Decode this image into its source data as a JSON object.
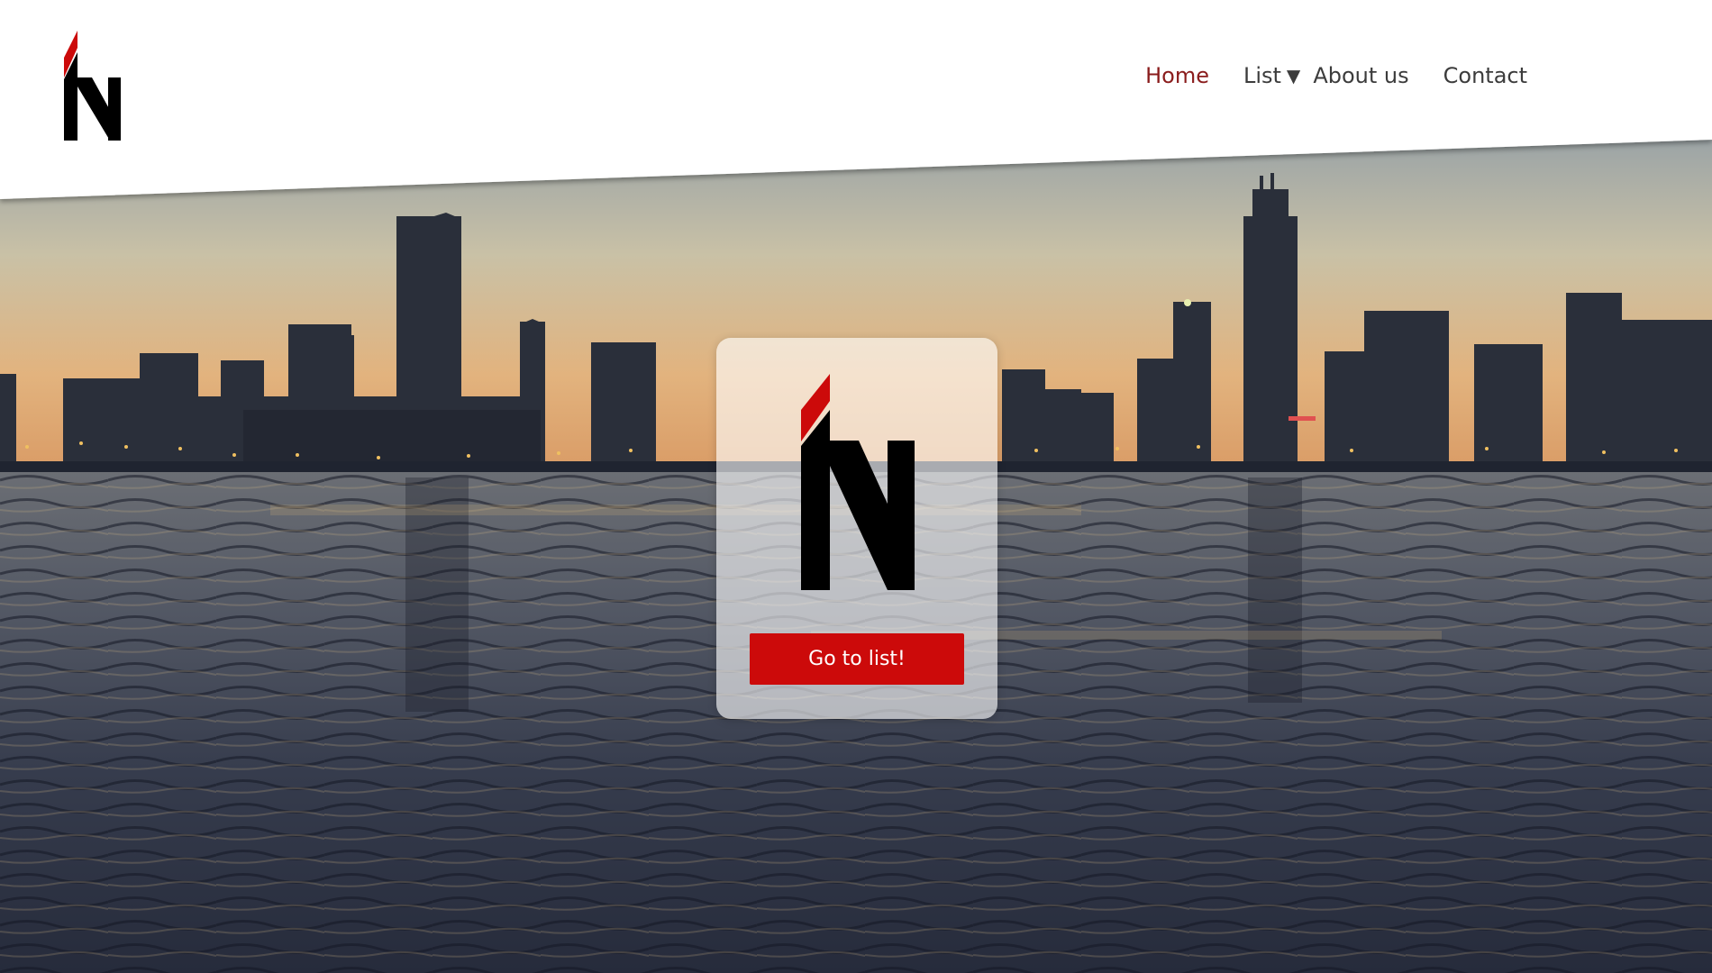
{
  "header": {
    "nav": {
      "home": "Home",
      "list": "List",
      "about": "About us",
      "contact": "Contact"
    },
    "active_item": "home",
    "icons": {
      "logo": "brand-n-logo",
      "list_caret": "caret-down-icon"
    }
  },
  "hero": {
    "background": "city-skyline-over-water-at-dusk",
    "card": {
      "logo": "brand-n-logo",
      "button_label": "Go to list!"
    }
  },
  "colors": {
    "brand_red": "#cc0a0a",
    "active_nav": "#8a1c1c",
    "nav_text": "#3c3c3c",
    "logo_black": "#000000"
  }
}
